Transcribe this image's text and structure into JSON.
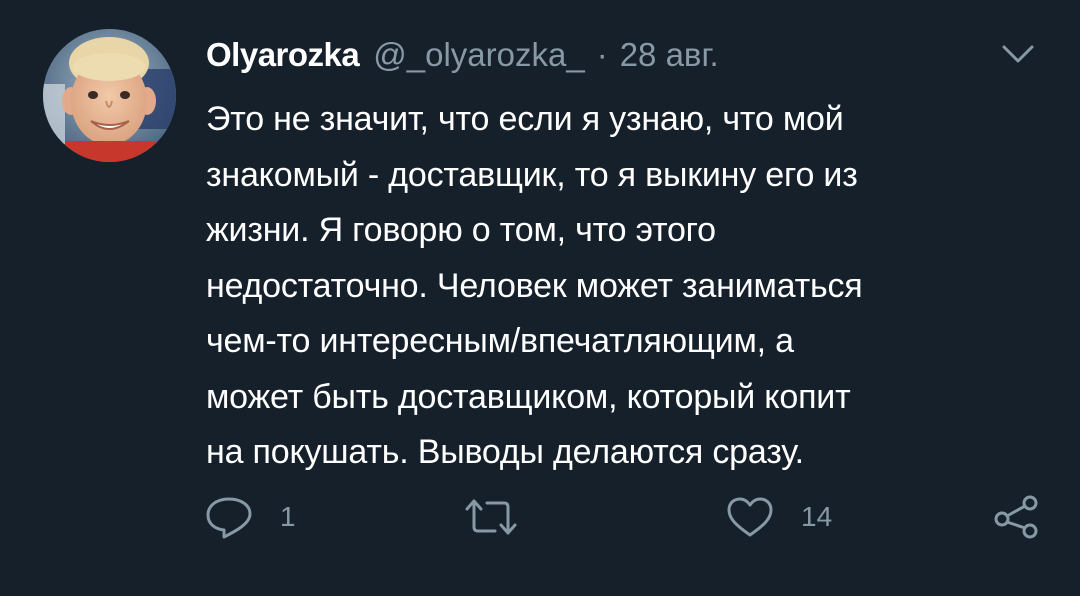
{
  "tweet": {
    "display_name": "Olyarozka",
    "handle": "@_olyarozka_",
    "separator": "·",
    "date": "28 авг.",
    "avatar": "user-avatar-photo",
    "menu_icon": "chevron-down-icon",
    "text_lines": [
      "Это не значит, что если я узнаю, что мой",
      "знакомый - доставщик, то я выкину его из",
      "жизни. Я говорю о том, что этого",
      "недостаточно. Человек может заниматься",
      "чем-то интересным/впечатляющим, а",
      "может быть доставщиком, который копит",
      "на покушать. Выводы делаются сразу."
    ],
    "actions": {
      "reply": {
        "icon": "reply-icon",
        "count": "1"
      },
      "retweet": {
        "icon": "retweet-icon",
        "count": ""
      },
      "like": {
        "icon": "heart-icon",
        "count": "14"
      },
      "share": {
        "icon": "share-icon"
      }
    }
  },
  "colors": {
    "background": "#15202b",
    "primary_text": "#ffffff",
    "secondary_text": "#8899a6"
  }
}
